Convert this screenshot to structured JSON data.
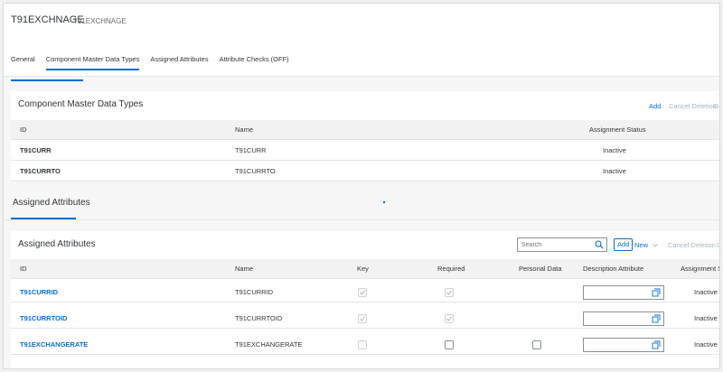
{
  "header": {
    "title": "T91EXCHNAGE",
    "subtitle": "T91EXCHNAGE",
    "tabs": [
      {
        "label": "General",
        "selected": false
      },
      {
        "label": "Component Master Data Types",
        "selected": true
      },
      {
        "label": "Assigned Attributes",
        "selected": false
      },
      {
        "label": "Attribute Checks (OFF)",
        "selected": false
      }
    ]
  },
  "component_section": {
    "title": "Component Master Data Types",
    "actions": {
      "add": "Add",
      "cancel_deletion": "Cancel Deletion",
      "delete": "De"
    },
    "columns": {
      "id": "ID",
      "name": "Name",
      "status": "Assignment Status"
    },
    "rows": [
      {
        "id": "T91CURR",
        "name": "T91CURR",
        "status": "Inactive"
      },
      {
        "id": "T91CURRTO",
        "name": "T91CURRTO",
        "status": "Inactive"
      }
    ]
  },
  "assigned_section": {
    "section_title": "Assigned Attributes",
    "table_title": "Assigned Attributes",
    "search_placeholder": "Search",
    "actions": {
      "add": "Add",
      "new": "New",
      "cancel_deletion": "Cancel Deletion",
      "delete": "De"
    },
    "columns": {
      "id": "ID",
      "name": "Name",
      "key": "Key",
      "required": "Required",
      "personal_data": "Personal Data",
      "description_attribute": "Description Attribute",
      "status": "Assignment Statu"
    },
    "rows": [
      {
        "id": "T91CURRID",
        "name": "T91CURRID",
        "key": true,
        "key_disabled": true,
        "required": true,
        "required_disabled": true,
        "personal_data": null,
        "status": "Inactive"
      },
      {
        "id": "T91CURRTOID",
        "name": "T91CURRTOID",
        "key": true,
        "key_disabled": true,
        "required": true,
        "required_disabled": true,
        "personal_data": null,
        "status": "Inactive"
      },
      {
        "id": "T91EXCHANGERATE",
        "name": "T91EXCHANGERATE",
        "key": false,
        "key_disabled": true,
        "required": false,
        "required_disabled": false,
        "personal_data": false,
        "status": "Inactive"
      }
    ]
  },
  "colors": {
    "accent": "#0a6ed1",
    "text": "#32363a",
    "disabled": "#a9b4be"
  }
}
